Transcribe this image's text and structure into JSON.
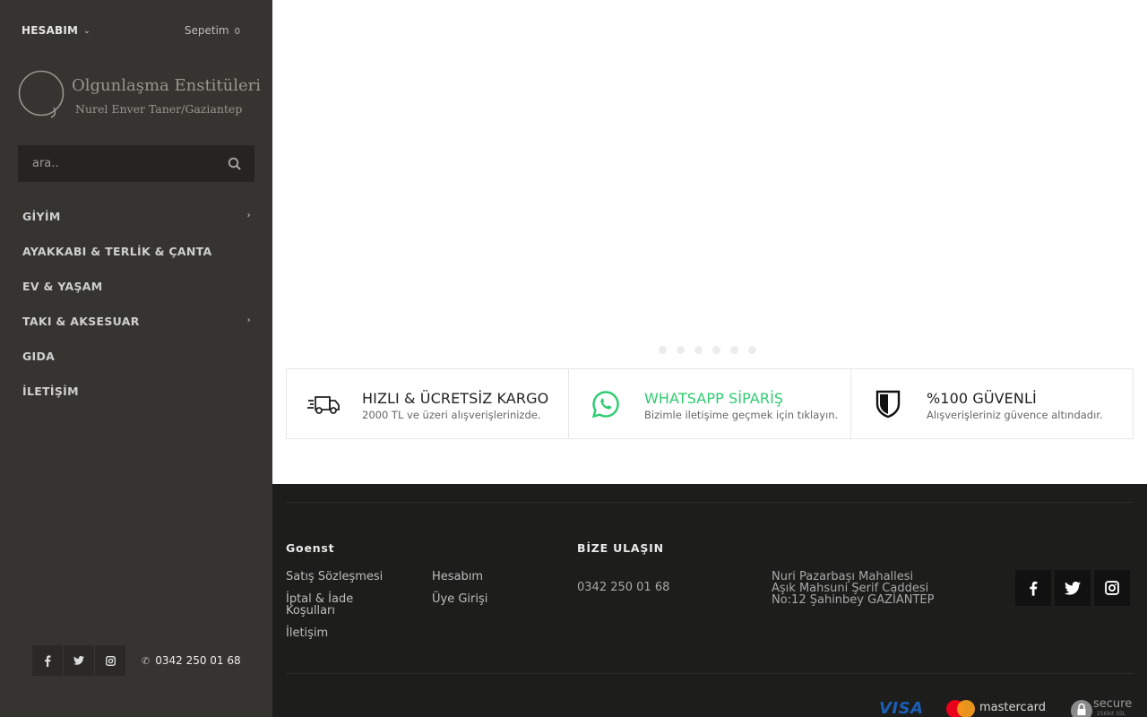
{
  "topbar": {
    "account_label": "HESABIM",
    "cart_label": "Sepetim",
    "cart_count": "0"
  },
  "logo": {
    "title": "Olgunlaşma Enstitüleri",
    "subtitle": "Nurel Enver Taner/Gaziantep"
  },
  "search": {
    "placeholder": "ara.."
  },
  "menu": [
    {
      "label": "GİYİM",
      "has_sub": true
    },
    {
      "label": "AYAKKABI & TERLİK & ÇANTA",
      "has_sub": false
    },
    {
      "label": "EV & YAŞAM",
      "has_sub": false
    },
    {
      "label": "TAKI & AKSESUAR",
      "has_sub": true
    },
    {
      "label": "GIDA",
      "has_sub": false
    },
    {
      "label": "İLETİŞİM",
      "has_sub": false
    }
  ],
  "sidebar_footer": {
    "phone": "0342 250 01 68",
    "social": [
      "facebook-icon",
      "twitter-icon",
      "instagram-icon"
    ]
  },
  "slider": {
    "dot_count": 6,
    "active_index": 0
  },
  "features": [
    {
      "icon": "delivery-truck-icon",
      "title": "HIZLI & ÜCRETSİZ KARGO",
      "desc": "2000 TL ve üzeri alışverişlerinizde."
    },
    {
      "icon": "whatsapp-icon",
      "title": "WHATSAPP SİPARİŞ",
      "desc": "Bizimle iletişime geçmek için tıklayın."
    },
    {
      "icon": "shield-icon",
      "title": "%100 GÜVENLİ",
      "desc": "Alışverişleriniz güvence altındadır."
    }
  ],
  "footer": {
    "brand_heading": "Goenst",
    "links_col1": [
      "Satış Sözleşmesi",
      "İptal & İade Koşulları",
      "İletişim"
    ],
    "links_col2": [
      "Hesabım",
      "Üye Girişi"
    ],
    "contact_heading": "BİZE ULAŞIN",
    "phone": "0342 250 01 68",
    "address": [
      "Nuri Pazarbaşı Mahallesi",
      "Aşık Mahsuni Şerif Caddesi",
      "No:12 Şahinbey GAZİANTEP"
    ],
    "social": [
      "facebook-icon",
      "twitter-icon",
      "instagram-icon"
    ],
    "payment": {
      "visa": "VISA",
      "mastercard": "mastercard",
      "secure": "secure",
      "secure_sub": "256bit SSL"
    }
  },
  "colors": {
    "sidebar": "#353431",
    "footer": "#1d1d1c",
    "whatsapp_green": "#2ecc71"
  }
}
